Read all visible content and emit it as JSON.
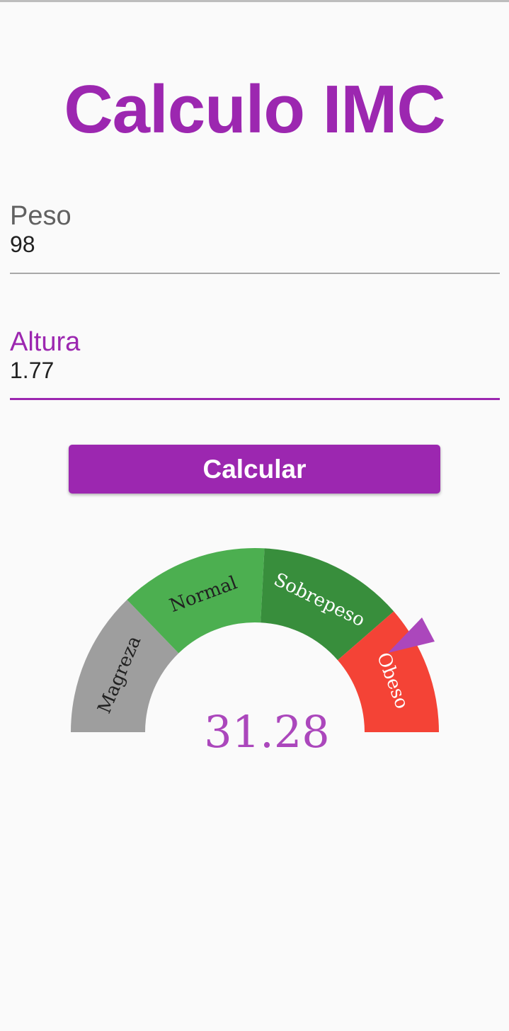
{
  "app": {
    "title": "Calculo IMC"
  },
  "form": {
    "peso": {
      "label": "Peso",
      "value": "98"
    },
    "altura": {
      "label": "Altura",
      "value": "1.77"
    }
  },
  "actions": {
    "calculate_label": "Calcular"
  },
  "gauge": {
    "value": "31.28",
    "segments": [
      {
        "label": "Magreza",
        "color": "#9e9e9e",
        "text_color": "#212121"
      },
      {
        "label": "Normal",
        "color": "#4caf50",
        "text_color": "#212121"
      },
      {
        "label": "Sobrepeso",
        "color": "#388e3c",
        "text_color": "#ffffff"
      },
      {
        "label": "Obeso",
        "color": "#f44336",
        "text_color": "#ffffff"
      }
    ]
  },
  "colors": {
    "accent": "#9c27b0",
    "value_text": "#ab47bc",
    "pointer": "#ab47bc",
    "inactive_line": "#a8a8a8"
  }
}
